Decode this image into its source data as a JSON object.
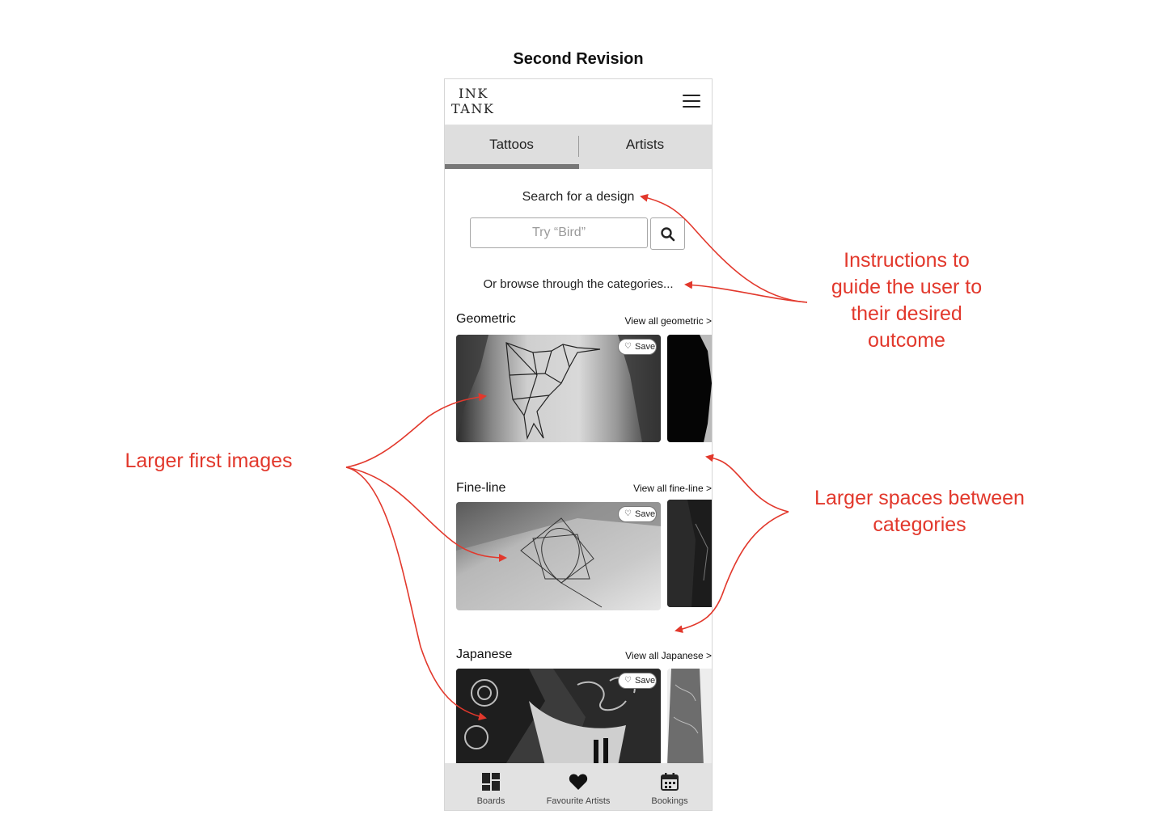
{
  "page_heading": "Second Revision",
  "app": {
    "logo_line1": "INK",
    "logo_line2": "TANK",
    "menu_icon": "hamburger-menu-icon"
  },
  "tabs": [
    {
      "label": "Tattoos",
      "active": true
    },
    {
      "label": "Artists",
      "active": false
    }
  ],
  "search": {
    "title": "Search for a design",
    "placeholder": "Try “Bird”",
    "button_icon": "search-icon"
  },
  "browse_text": "Or browse through the categories...",
  "categories": [
    {
      "name": "Geometric",
      "view_all": "View all geometric >",
      "save_label": "Save"
    },
    {
      "name": "Fine-line",
      "view_all": "View all fine-line >",
      "save_label": "Save"
    },
    {
      "name": "Japanese",
      "view_all": "View all Japanese >",
      "save_label": "Save"
    }
  ],
  "bottom_nav": [
    {
      "label": "Boards",
      "icon": "boards-icon"
    },
    {
      "label": "Favourite Artists",
      "icon": "heart-icon"
    },
    {
      "label": "Bookings",
      "icon": "calendar-icon"
    }
  ],
  "annotations": {
    "instructions": [
      "Instructions to",
      "guide the user to",
      "their desired",
      "outcome"
    ],
    "larger_images": "Larger first images",
    "larger_spaces": [
      "Larger spaces between",
      "categories"
    ]
  },
  "colors": {
    "annotation": "#e2382c",
    "tab_bar": "#dedede",
    "bottom_nav": "#e2e2e2"
  }
}
